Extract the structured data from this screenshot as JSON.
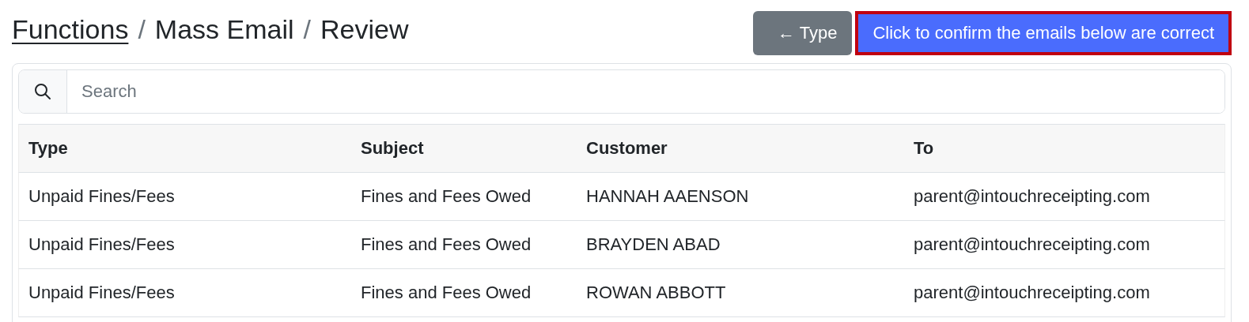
{
  "breadcrumb": [
    {
      "label": "Functions",
      "link": true
    },
    {
      "label": "Mass Email",
      "link": false
    },
    {
      "label": "Review",
      "link": false
    }
  ],
  "breadcrumb_separator": "/",
  "buttons": [
    {
      "label": "← Type",
      "kind": "secondary",
      "highlighted": false
    },
    {
      "label": "Click to confirm the emails below are correct",
      "kind": "primary",
      "highlighted": true
    }
  ],
  "search": {
    "placeholder": "Search"
  },
  "table": {
    "columns": [
      "Type",
      "Subject",
      "Customer",
      "To"
    ],
    "rows": [
      [
        "Unpaid Fines/Fees",
        "Fines and Fees Owed",
        "HANNAH AAENSON",
        "parent@intouchreceipting.com"
      ],
      [
        "Unpaid Fines/Fees",
        "Fines and Fees Owed",
        "BRAYDEN ABAD",
        "parent@intouchreceipting.com"
      ],
      [
        "Unpaid Fines/Fees",
        "Fines and Fees Owed",
        "ROWAN ABBOTT",
        "parent@intouchreceipting.com"
      ]
    ]
  }
}
